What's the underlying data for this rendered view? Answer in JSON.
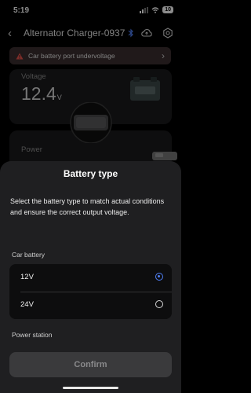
{
  "status_bar": {
    "time": "5:19",
    "battery": "10"
  },
  "header": {
    "title": "Alternator Charger-0937"
  },
  "alert": {
    "text": "Car battery port undervoltage"
  },
  "voltage_card": {
    "label": "Voltage",
    "value": "12.4",
    "unit": "V"
  },
  "power_card": {
    "label": "Power"
  },
  "sheet": {
    "title": "Battery type",
    "description": "Select the battery type to match actual conditions and ensure the correct output voltage.",
    "car_battery_label": "Car battery",
    "options": [
      {
        "label": "12V",
        "selected": true
      },
      {
        "label": "24V",
        "selected": false
      }
    ],
    "power_station_label": "Power station",
    "confirm_label": "Confirm"
  },
  "colors": {
    "accent": "#4f7ff5",
    "alert_bg": "#3b2f30",
    "alert_icon": "#e5534b"
  }
}
